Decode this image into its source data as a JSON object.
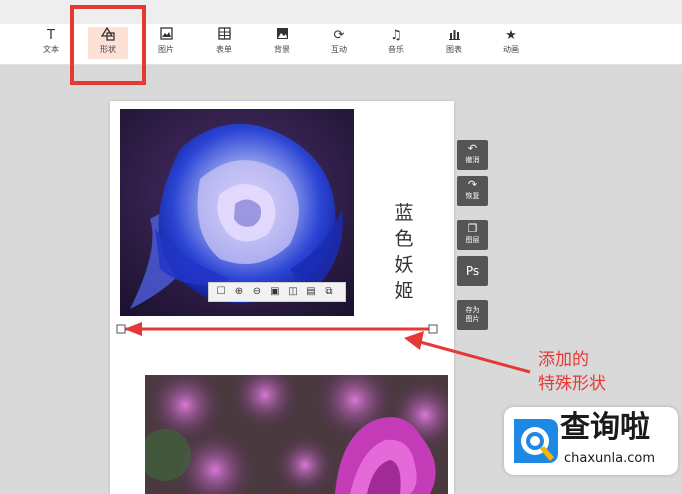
{
  "toolbar": {
    "items": [
      {
        "label": "文本",
        "icon": "text-icon"
      },
      {
        "label": "形状",
        "icon": "shape-icon",
        "active": true
      },
      {
        "label": "图片",
        "icon": "image-icon"
      },
      {
        "label": "表单",
        "icon": "form-icon"
      },
      {
        "label": "背景",
        "icon": "background-icon"
      },
      {
        "label": "互动",
        "icon": "interact-icon"
      },
      {
        "label": "音乐",
        "icon": "music-icon"
      },
      {
        "label": "图表",
        "icon": "chart-icon"
      },
      {
        "label": "动画",
        "icon": "animation-icon"
      }
    ]
  },
  "canvas": {
    "vertical_text": [
      "蓝",
      "色",
      "妖",
      "姬"
    ]
  },
  "side_tools": [
    {
      "label": "撤消",
      "icon": "undo-icon"
    },
    {
      "label": "恢复",
      "icon": "redo-icon"
    },
    {
      "label": "图层",
      "icon": "layers-icon"
    },
    {
      "label": "Ps",
      "icon": "ps-icon"
    },
    {
      "label": "存为图片",
      "icon": "save-image-icon"
    }
  ],
  "annotation": {
    "line1": "添加的",
    "line2": "特殊形状"
  },
  "watermark": {
    "title": "查询啦",
    "url": "chaxunla.com"
  },
  "colors": {
    "highlight_red": "#e53935",
    "active_tool_bg": "#fde0d6",
    "side_tool_bg": "#555555"
  }
}
